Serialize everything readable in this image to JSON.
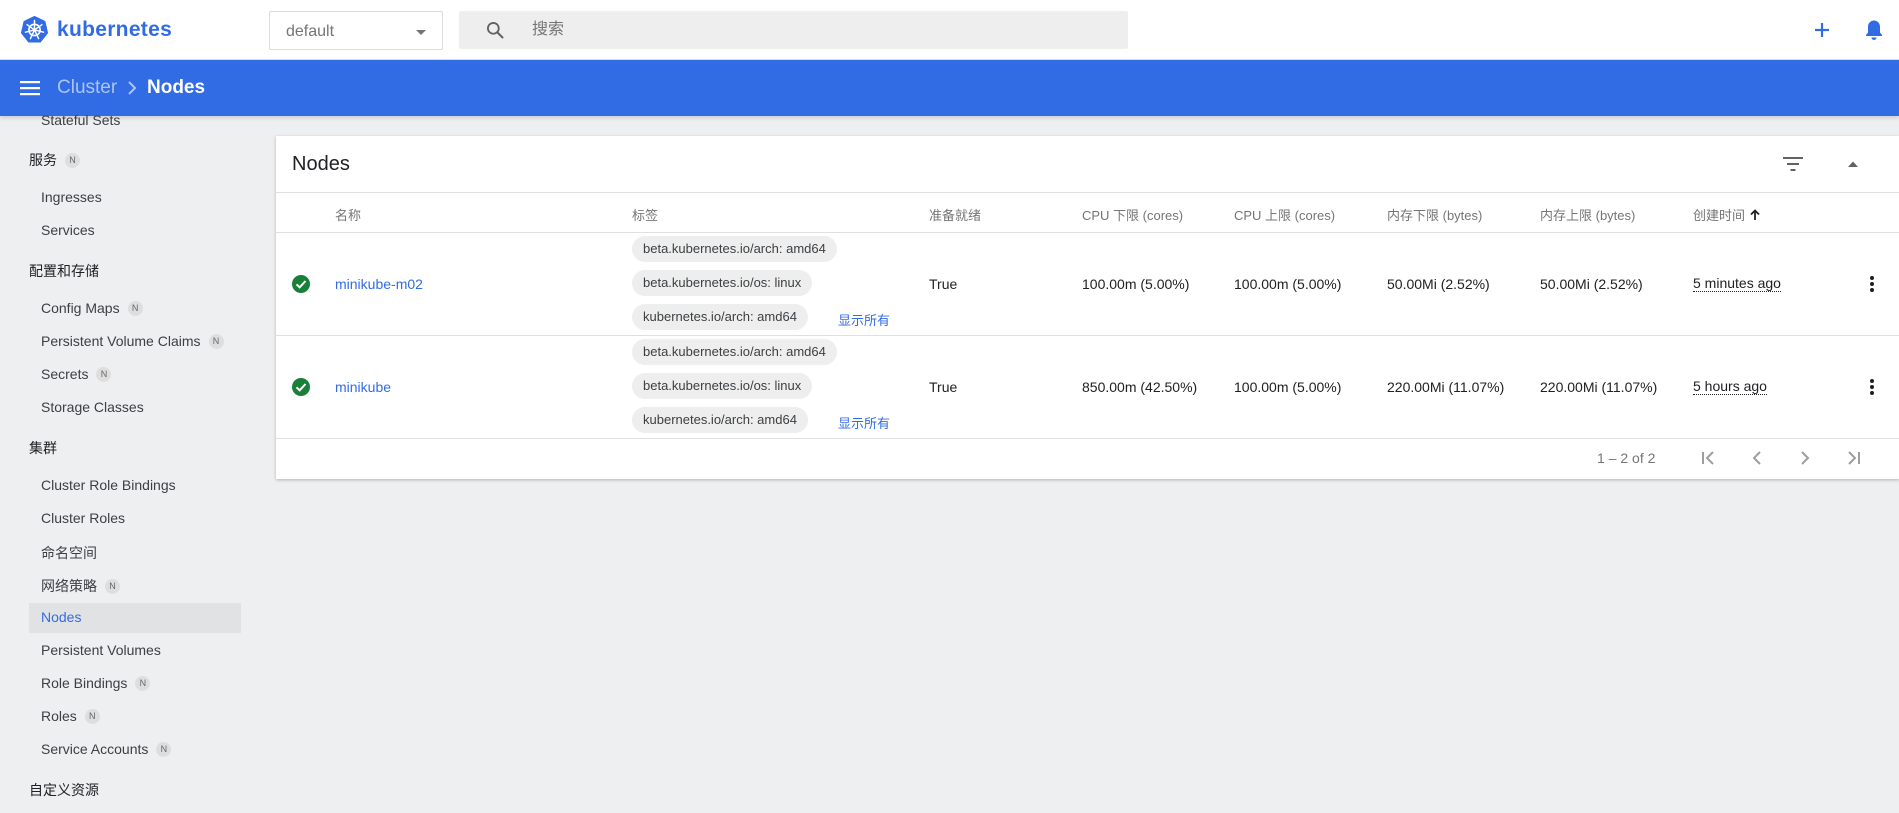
{
  "topbar": {
    "logo_text": "kubernetes",
    "namespace": "default",
    "search_placeholder": "搜索"
  },
  "breadcrumb": {
    "parent": "Cluster",
    "current": "Nodes"
  },
  "sidebar": {
    "items": [
      {
        "label": "Stateful Sets",
        "type": "item",
        "badge": ""
      },
      {
        "label": "服务",
        "type": "category",
        "badge": "N"
      },
      {
        "label": "Ingresses",
        "type": "item",
        "badge": ""
      },
      {
        "label": "Services",
        "type": "item",
        "badge": ""
      },
      {
        "label": "配置和存储",
        "type": "category",
        "badge": ""
      },
      {
        "label": "Config Maps",
        "type": "item",
        "badge": "N"
      },
      {
        "label": "Persistent Volume Claims",
        "type": "item",
        "badge": "N"
      },
      {
        "label": "Secrets",
        "type": "item",
        "badge": "N"
      },
      {
        "label": "Storage Classes",
        "type": "item",
        "badge": ""
      },
      {
        "label": "集群",
        "type": "category",
        "badge": ""
      },
      {
        "label": "Cluster Role Bindings",
        "type": "item",
        "badge": ""
      },
      {
        "label": "Cluster Roles",
        "type": "item",
        "badge": ""
      },
      {
        "label": "命名空间",
        "type": "item",
        "badge": ""
      },
      {
        "label": "网络策略",
        "type": "item",
        "badge": "N"
      },
      {
        "label": "Nodes",
        "type": "item",
        "badge": "",
        "active": true
      },
      {
        "label": "Persistent Volumes",
        "type": "item",
        "badge": ""
      },
      {
        "label": "Role Bindings",
        "type": "item",
        "badge": "N"
      },
      {
        "label": "Roles",
        "type": "item",
        "badge": "N"
      },
      {
        "label": "Service Accounts",
        "type": "item",
        "badge": "N"
      },
      {
        "label": "自定义资源",
        "type": "category",
        "badge": ""
      }
    ]
  },
  "card": {
    "title": "Nodes",
    "columns": [
      "名称",
      "标签",
      "准备就绪",
      "CPU 下限 (cores)",
      "CPU 上限 (cores)",
      "内存下限 (bytes)",
      "内存上限 (bytes)",
      "创建时间"
    ],
    "rows": [
      {
        "name": "minikube-m02",
        "labels": [
          "beta.kubernetes.io/arch: amd64",
          "beta.kubernetes.io/os: linux",
          "kubernetes.io/arch: amd64"
        ],
        "show_all": "显示所有",
        "ready": "True",
        "cpu_req": "100.00m (5.00%)",
        "cpu_lim": "100.00m (5.00%)",
        "mem_req": "50.00Mi (2.52%)",
        "mem_lim": "50.00Mi (2.52%)",
        "age": "5 minutes ago"
      },
      {
        "name": "minikube",
        "labels": [
          "beta.kubernetes.io/arch: amd64",
          "beta.kubernetes.io/os: linux",
          "kubernetes.io/arch: amd64"
        ],
        "show_all": "显示所有",
        "ready": "True",
        "cpu_req": "850.00m (42.50%)",
        "cpu_lim": "100.00m (5.00%)",
        "mem_req": "220.00Mi (11.07%)",
        "mem_lim": "220.00Mi (11.07%)",
        "age": "5 hours ago"
      }
    ],
    "pagination": "1 – 2 of 2"
  },
  "colors": {
    "brand_blue": "#326ce5",
    "status_green": "#188038"
  },
  "icons": [
    "kubernetes-logo-icon",
    "search-icon",
    "add-icon",
    "bell-icon",
    "menu-icon",
    "chevron-right-icon",
    "filter-icon",
    "collapse-icon",
    "check-circle-icon",
    "more-vert-icon",
    "first-page-icon",
    "prev-page-icon",
    "next-page-icon",
    "last-page-icon"
  ]
}
